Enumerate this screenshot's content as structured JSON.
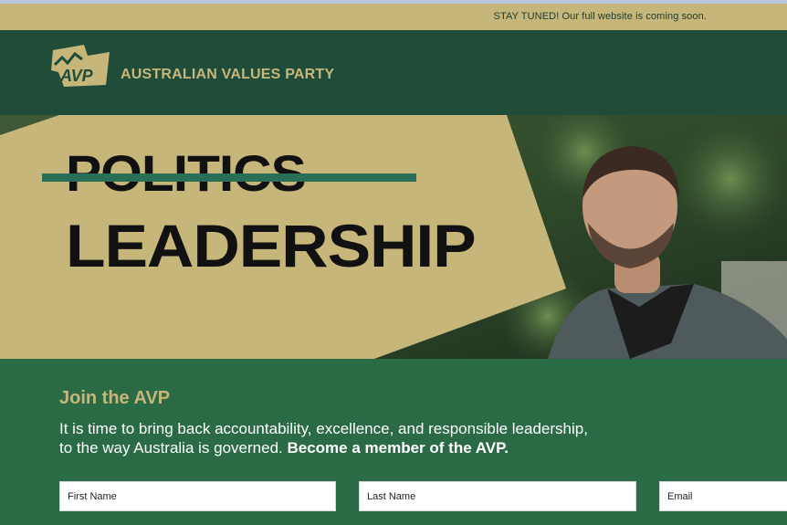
{
  "announcement": {
    "text": "STAY TUNED! Our full website is coming soon."
  },
  "brand": {
    "logo_text": "AVP",
    "name": "AUSTRALIAN VALUES PARTY"
  },
  "hero": {
    "struck_word": "POLITICS",
    "main_word": "LEADERSHIP",
    "colors": {
      "gold": "#c7b67a",
      "strike": "#2a6e57"
    }
  },
  "join": {
    "title": "Join the AVP",
    "body_line1": "It is time to bring back accountability, excellence, and responsible leadership,",
    "body_line2": "to the way Australia is governed. ",
    "body_cta": "Become a member of the AVP.",
    "fields": {
      "first_name": {
        "placeholder": "First Name"
      },
      "last_name": {
        "placeholder": "Last Name"
      },
      "email": {
        "placeholder": "Email"
      }
    }
  },
  "colors": {
    "gold": "#c7b67a",
    "dark_green": "#1f4d3a",
    "green": "#2a6a45"
  }
}
